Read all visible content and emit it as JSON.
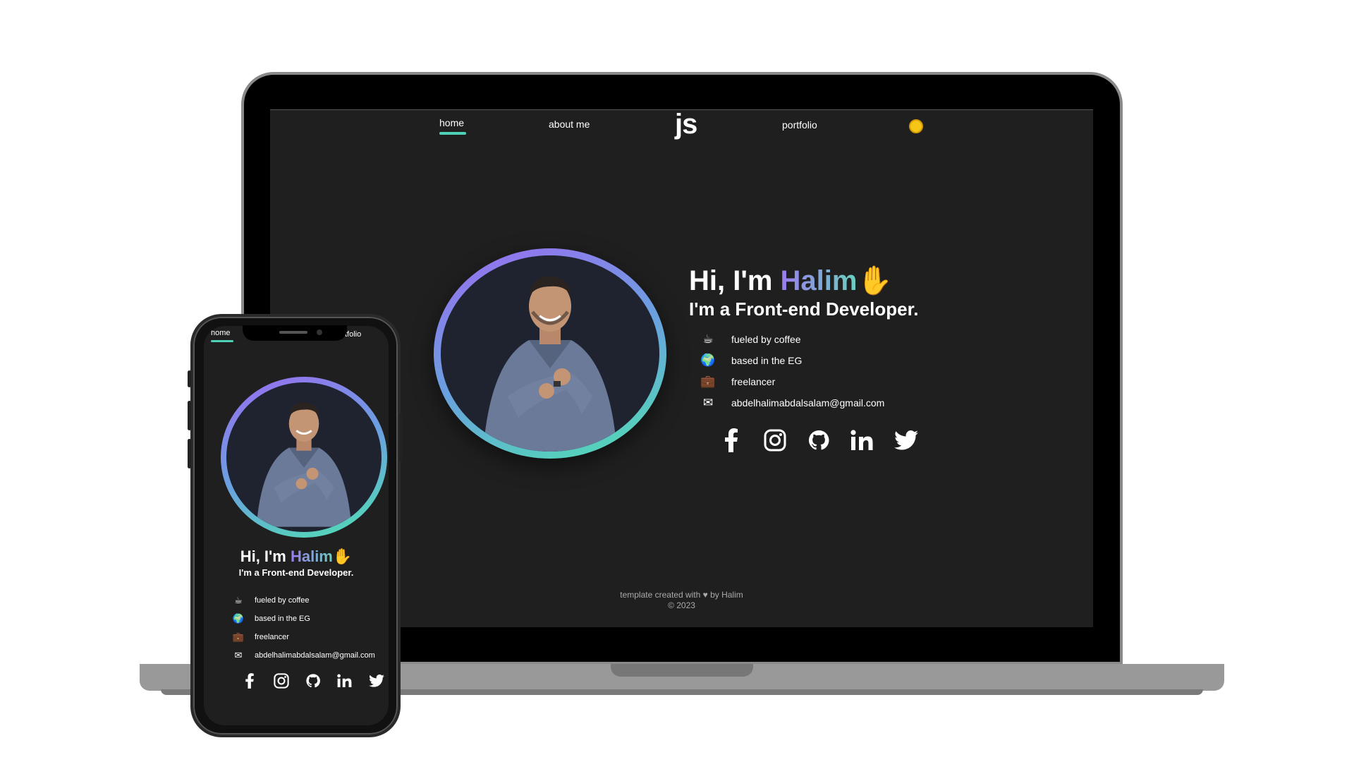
{
  "laptop_site": {
    "nav": {
      "home": "home",
      "about": "about me",
      "logo": "js",
      "portfolio": "portfolio"
    },
    "hero": {
      "greeting_prefix": "Hi, I'm ",
      "name": "Halim",
      "wave_emoji": "✋",
      "subtitle": "I'm a Front-end Developer.",
      "facts": [
        {
          "icon": "coffee-icon",
          "glyph": "☕",
          "text": "fueled by coffee"
        },
        {
          "icon": "globe-icon",
          "glyph": "🌍",
          "text": "based in the EG"
        },
        {
          "icon": "briefcase-icon",
          "glyph": "💼",
          "text": "freelancer"
        },
        {
          "icon": "envelope-icon",
          "glyph": "✉",
          "text": "abdelhalimabdalsalam@gmail.com"
        }
      ],
      "socials": [
        "facebook-icon",
        "instagram-icon",
        "github-icon",
        "linkedin-icon",
        "twitter-icon"
      ]
    },
    "footer": {
      "line1": "template created with ♥ by Halim",
      "line2": "© 2023"
    }
  },
  "phone_site": {
    "nav": {
      "home": "home",
      "portfolio": "tfolio"
    },
    "hero": {
      "greeting_prefix": "Hi, I'm ",
      "name": "Halim",
      "wave_emoji": "✋",
      "subtitle": "I'm a Front-end Developer.",
      "facts": [
        {
          "icon": "coffee-icon",
          "glyph": "☕",
          "text": "fueled by coffee"
        },
        {
          "icon": "globe-icon",
          "glyph": "🌍",
          "text": "based in the EG"
        },
        {
          "icon": "briefcase-icon",
          "glyph": "💼",
          "text": "freelancer"
        },
        {
          "icon": "envelope-icon",
          "glyph": "✉",
          "text": "abdelhalimabdalsalam@gmail.com"
        }
      ]
    }
  },
  "colors": {
    "accent_teal": "#4fd1b5",
    "accent_purple": "#9b6cf0",
    "background": "#1f1f1f",
    "theme_toggle": "#f5c518"
  }
}
